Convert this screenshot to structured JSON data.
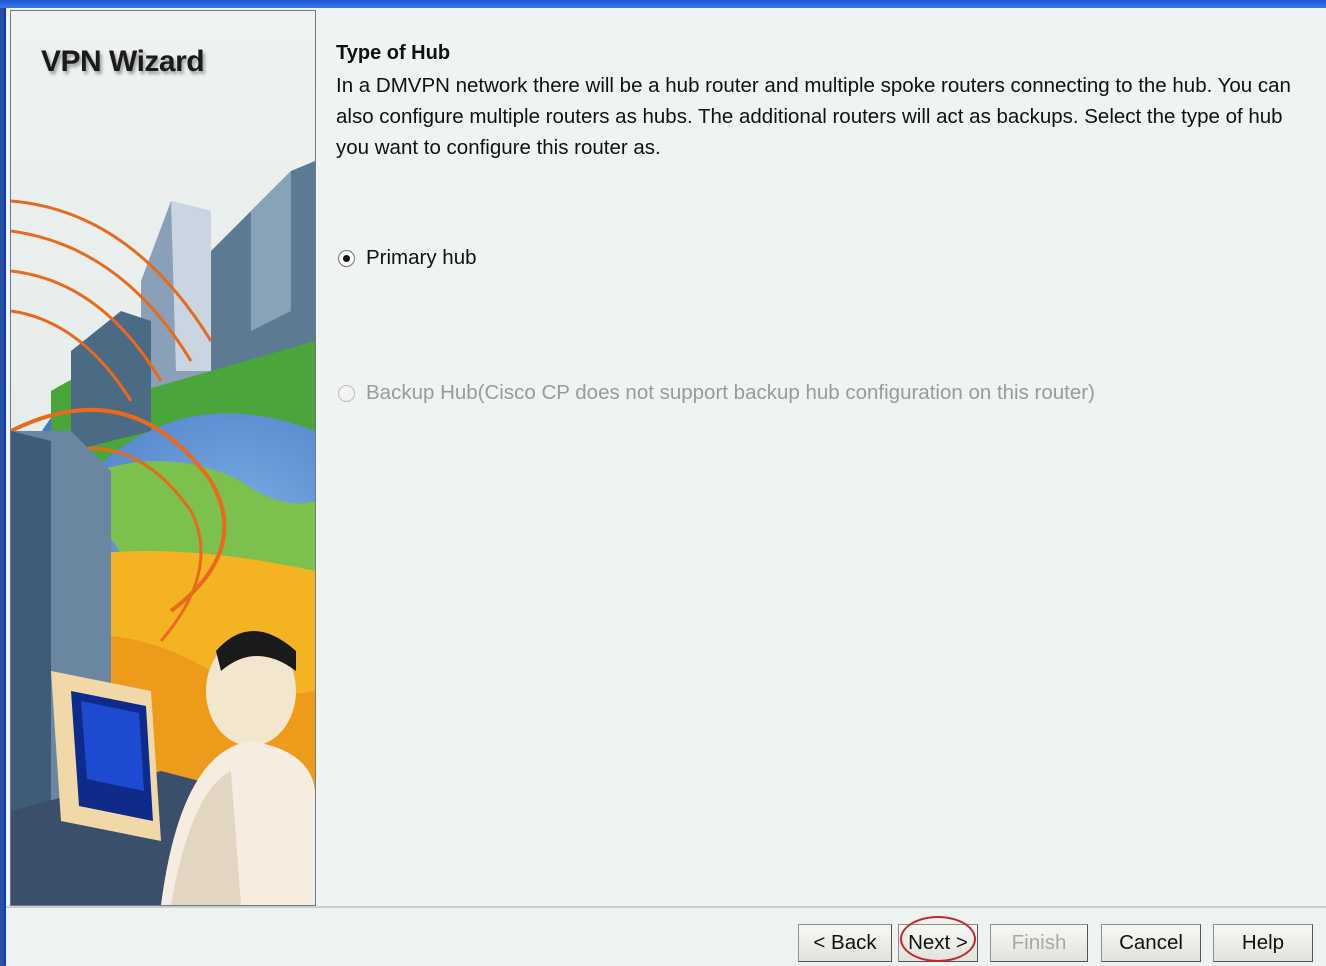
{
  "wizard": {
    "side_title": "VPN Wizard"
  },
  "page": {
    "heading": "Type of Hub",
    "description": "In a DMVPN network there will be a hub router and multiple spoke routers connecting to the hub. You can also configure multiple routers as hubs. The additional routers will act as backups. Select the type of hub you want to configure this router as."
  },
  "options": {
    "primary": {
      "label": "Primary hub",
      "selected": true,
      "enabled": true
    },
    "backup": {
      "label": "Backup Hub(Cisco CP does not support backup hub configuration on this router)",
      "selected": false,
      "enabled": false
    }
  },
  "buttons": {
    "back": "< Back",
    "next": "Next >",
    "finish": "Finish",
    "cancel": "Cancel",
    "help": "Help"
  },
  "colors": {
    "window_border": "#0b3dc2",
    "highlight_ring": "#c0272d"
  }
}
